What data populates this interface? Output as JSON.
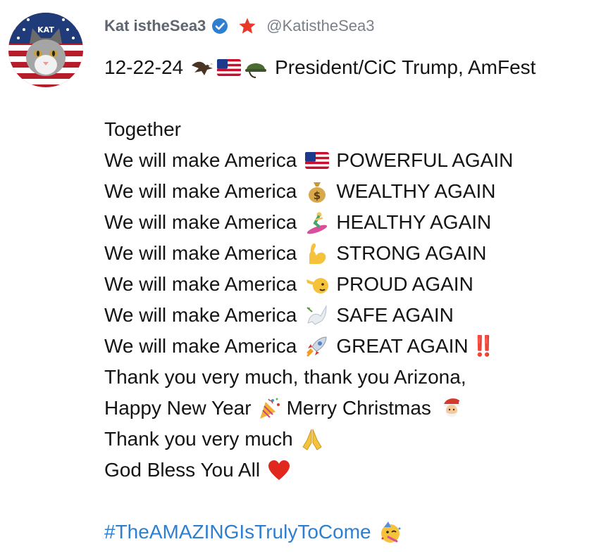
{
  "author": {
    "display_name": "Kat istheSea3",
    "handle": "@KatistheSea3",
    "avatar_text": "KAT"
  },
  "icons": {
    "verified": "verified-badge-icon",
    "star": "red-star-icon"
  },
  "colors": {
    "name": "#5f6670",
    "handle": "#7a8089",
    "verified": "#2f7fd0",
    "star": "#e8382a",
    "hashtag": "#2f7fd0",
    "text": "#141414"
  },
  "post": {
    "date_line": {
      "date": "12-22-24",
      "emojis": [
        "eagle",
        "us-flag",
        "military-helmet"
      ],
      "text": "President/CiC Trump, AmFest"
    },
    "together": "Together",
    "make_lines": [
      {
        "prefix": "We will make America",
        "emoji": "us-flag",
        "suffix": "POWERFUL AGAIN"
      },
      {
        "prefix": "We will make America",
        "emoji": "money-bag",
        "suffix": "WEALTHY AGAIN"
      },
      {
        "prefix": "We will make America",
        "emoji": "surfer",
        "suffix": "HEALTHY AGAIN"
      },
      {
        "prefix": "We will make America",
        "emoji": "flexed-biceps",
        "suffix": "STRONG AGAIN"
      },
      {
        "prefix": "We will make America",
        "emoji": "saluting-face",
        "suffix": "PROUD AGAIN"
      },
      {
        "prefix": "We will make America",
        "emoji": "dove",
        "suffix": "SAFE AGAIN"
      },
      {
        "prefix": "We will make America",
        "emoji": "rocket",
        "suffix": "GREAT AGAIN",
        "trailing": "‼️"
      }
    ],
    "thanks_line": "Thank you very much, thank you Arizona,",
    "new_year_line": {
      "part1": "Happy New Year",
      "emoji1": "party-popper",
      "part2": "Merry Christmas",
      "emoji2": "santa"
    },
    "thanks_again": {
      "text": "Thank you very much",
      "emoji": "folded-hands"
    },
    "bless_line": {
      "text": "God Bless You All",
      "emoji": "red-heart"
    },
    "hashtag": {
      "text": "#TheAMAZINGIsTrulyToCome",
      "emoji": "partying-face"
    }
  }
}
